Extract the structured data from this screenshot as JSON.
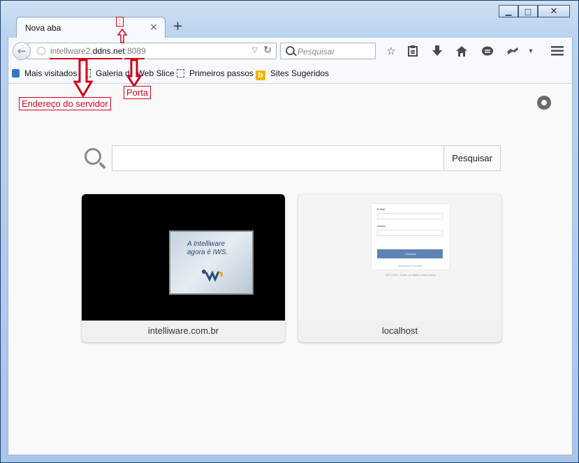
{
  "window": {
    "minimize": "▁",
    "maximize": "□",
    "close": "✕"
  },
  "tab": {
    "title": "Nova aba",
    "close": "×",
    "new_tab": "+"
  },
  "toolbar": {
    "url_host_prefix": "intellware2.",
    "url_host_domain": "ddns.net",
    "url_port_part": ":8089",
    "search_placeholder": "Pesquisar"
  },
  "bookmarks": [
    {
      "label": "Mais visitados",
      "icon": "most-visited-icon"
    },
    {
      "label": "Galeria do Web Slice",
      "icon": "webslice-icon"
    },
    {
      "label": "Primeiros passos",
      "icon": "page-icon"
    },
    {
      "label": "Sites Sugeridos",
      "icon": "bing-icon"
    }
  ],
  "annotations": {
    "colon": ":",
    "server": "Endereço do servidor",
    "port": "Porta"
  },
  "content": {
    "search_button": "Pesquisar",
    "tiles": [
      {
        "label": "intelliware.com.br",
        "thumb_line1": "A Intelliware",
        "thumb_line2": "agora é IWS."
      },
      {
        "label": "localhost",
        "email": "E-Mail",
        "password": "Senha",
        "button": "✓Acessar",
        "forgot": "Esqueceu a senha?",
        "footer": "IWS 2015 - Todos os direitos reservados."
      }
    ]
  },
  "colors": {
    "annotation": "#d0021b"
  }
}
